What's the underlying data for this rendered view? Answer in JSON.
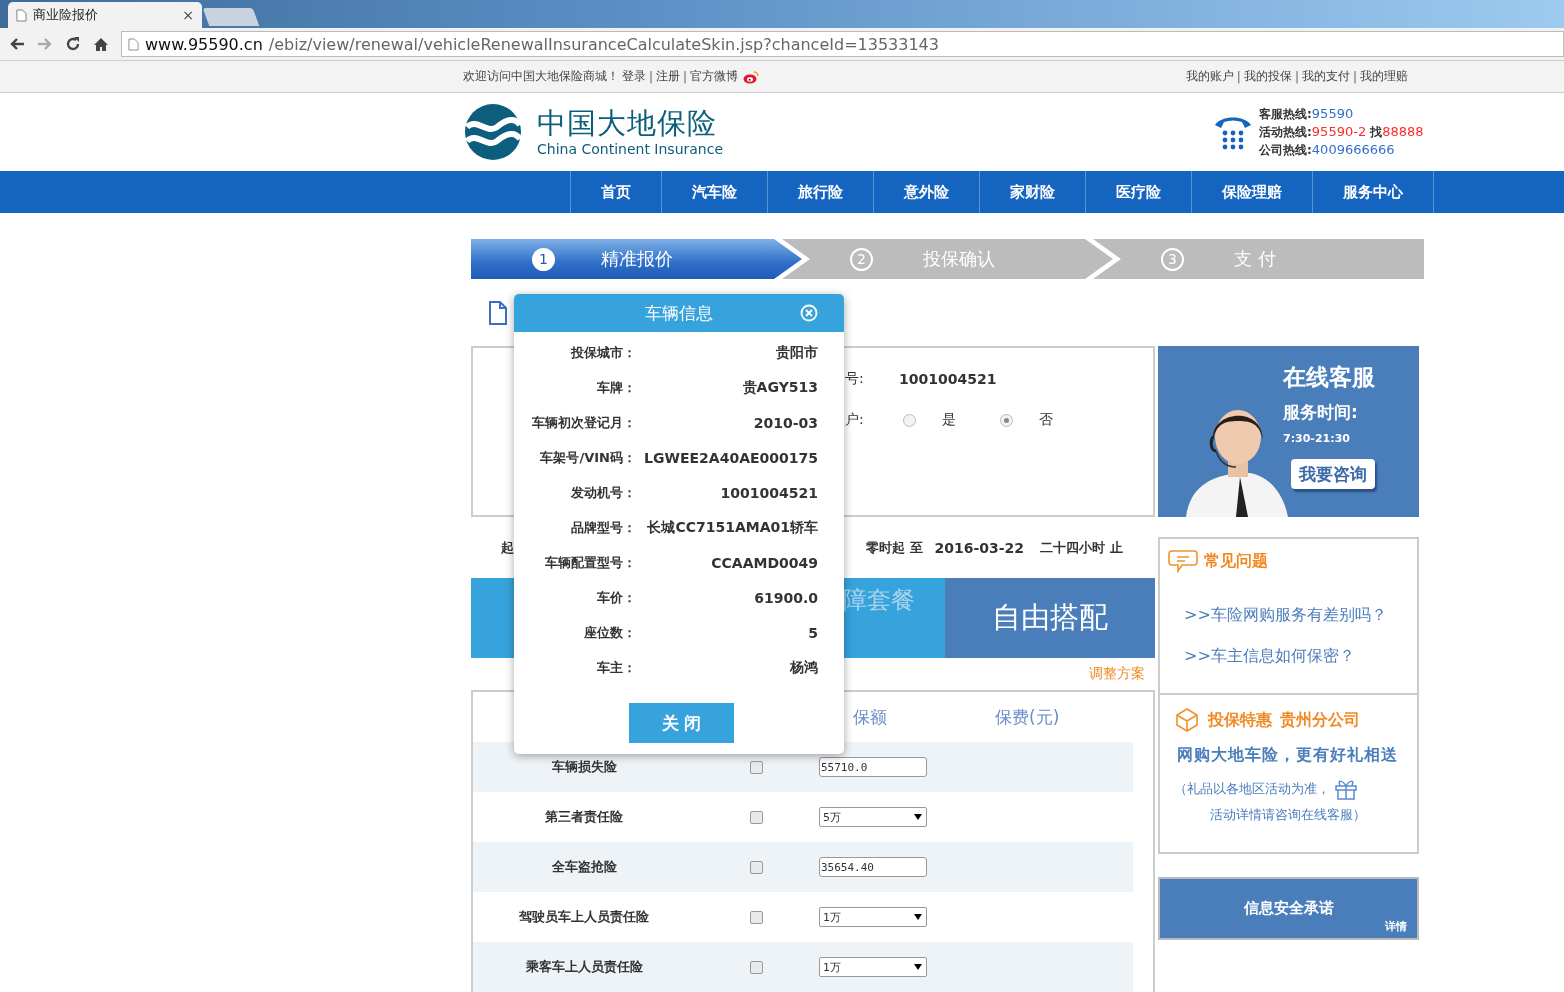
{
  "browser": {
    "tab_title": "商业险报价",
    "tab_close": "×",
    "url_host": "www.95590.cn",
    "url_path": "/ebiz/view/renewal/vehicleRenewalInsuranceCalculateSkin.jsp?chanceId=13533143"
  },
  "top_bar": {
    "welcome": "欢迎访问中国大地保险商城！",
    "left_links": [
      "登录",
      "注册",
      "官方微博"
    ],
    "right_links": [
      "我的账户",
      "我的投保",
      "我的支付",
      "我的理赔"
    ],
    "separator": "|"
  },
  "header": {
    "logo_cn": "中国大地保险",
    "logo_en": "China Continent Insurance",
    "hotlines": [
      {
        "label": "客服热线:",
        "value": "95590",
        "color": "#2f6fcf"
      },
      {
        "label": "活动热线:",
        "value": "95590-2",
        "color": "#ff2b2b",
        "suffix_label": "找",
        "suffix_value": "88888"
      },
      {
        "label": "公司热线:",
        "value": "4009666666",
        "color": "#2f6fcf"
      }
    ]
  },
  "nav": [
    "首页",
    "汽车险",
    "旅行险",
    "意外险",
    "家财险",
    "医疗险",
    "保险理赔",
    "服务中心"
  ],
  "steps": [
    {
      "number": "1",
      "label": "精准报价",
      "selected": true
    },
    {
      "number": "2",
      "label": "投保确认",
      "selected": false
    },
    {
      "number": "3",
      "label": "支 付",
      "selected": false
    }
  ],
  "form": {
    "engine_label": "号:",
    "engine_value": "1001004521",
    "transfer_label": "户:",
    "transfer_options": [
      {
        "label": "是",
        "selected": false
      },
      {
        "label": "否",
        "selected": true
      }
    ],
    "start_label": "起",
    "period_text": "零时起 至",
    "end_date": "2016-03-22",
    "end_text": "二十四小时 止"
  },
  "plans": {
    "package_label": "障套餐",
    "custom_label": "自由搭配",
    "adjust_link": "调整方案"
  },
  "coverage_table": {
    "columns": [
      "保额",
      "保费(元)"
    ],
    "rows": [
      {
        "name": "车辆损失险",
        "checked": false,
        "kind": "input",
        "value": "55710.0"
      },
      {
        "name": "第三者责任险",
        "checked": false,
        "kind": "select",
        "value": "5万"
      },
      {
        "name": "全车盗抢险",
        "checked": false,
        "kind": "input",
        "value": "35654.40"
      },
      {
        "name": "驾驶员车上人员责任险",
        "checked": false,
        "kind": "select",
        "value": "1万"
      },
      {
        "name": "乘客车上人员责任险",
        "checked": false,
        "kind": "select",
        "value": "1万"
      }
    ]
  },
  "service": {
    "title": "在线客服",
    "hours_label": "服务时间:",
    "hours": "7:30-21:30",
    "button": "我要咨询"
  },
  "faq": {
    "title": "常见问题",
    "items": [
      ">>车险网购服务有差别吗？",
      ">>车主信息如何保密？"
    ]
  },
  "promo": {
    "title": "投保特惠",
    "branch": "贵州分公司",
    "headline": "网购大地车险，更有好礼相送",
    "note_1": "（礼品以各地区活动为准，",
    "note_2": "活动详情请咨询在线客服）"
  },
  "security": {
    "title": "信息安全承诺",
    "detail": "详情"
  },
  "modal": {
    "title": "车辆信息",
    "fields": [
      {
        "label": "投保城市：",
        "value": "贵阳市"
      },
      {
        "label": "车牌：",
        "value": "贵AGY513"
      },
      {
        "label": "车辆初次登记月：",
        "value": "2010-03"
      },
      {
        "label": "车架号/VIN码：",
        "value": "LGWEE2A40AE000175"
      },
      {
        "label": "发动机号：",
        "value": "1001004521"
      },
      {
        "label": "品牌型号：",
        "value": "长城CC7151AMA01轿车"
      },
      {
        "label": "车辆配置型号：",
        "value": "CCAAMD0049"
      },
      {
        "label": "车价：",
        "value": "61900.0"
      },
      {
        "label": "座位数：",
        "value": "5"
      },
      {
        "label": "车主：",
        "value": "杨鸿"
      }
    ],
    "close_button": "关 闭"
  }
}
